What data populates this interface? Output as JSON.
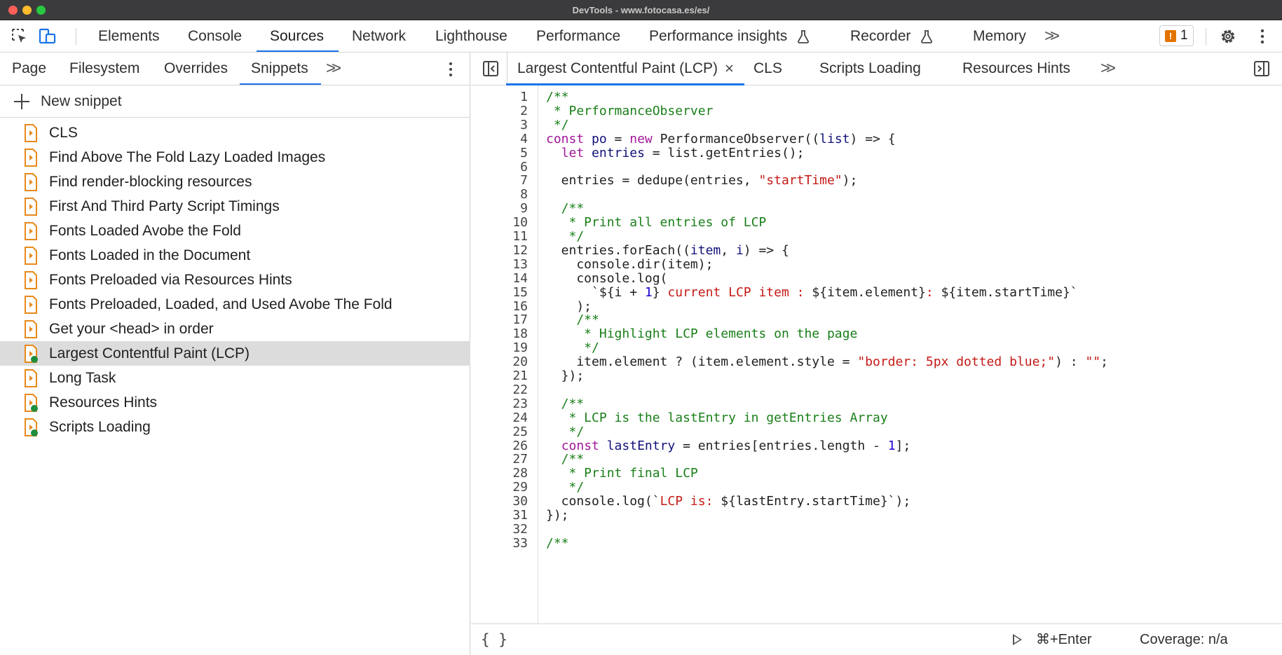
{
  "window": {
    "title": "DevTools - www.fotocasa.es/es/"
  },
  "colors": {
    "accent": "#1a73e8",
    "snippet_icon": "#e8891a",
    "running_dot": "#1e8e3e",
    "issue": "#e37400"
  },
  "toolbar": {
    "inspect_icon": "inspect-element-icon",
    "device_icon": "device-toolbar-icon",
    "tabs": [
      {
        "label": "Elements",
        "active": false
      },
      {
        "label": "Console",
        "active": false
      },
      {
        "label": "Sources",
        "active": true
      },
      {
        "label": "Network",
        "active": false
      },
      {
        "label": "Lighthouse",
        "active": false
      },
      {
        "label": "Performance",
        "active": false
      },
      {
        "label": "Performance insights",
        "active": false,
        "flask": true
      },
      {
        "label": "Recorder",
        "active": false,
        "flask": true
      },
      {
        "label": "Memory",
        "active": false
      }
    ],
    "more_tabs_icon": "chevron-double-right-icon",
    "issues_count": "1",
    "settings_icon": "gear-icon",
    "menu_icon": "kebab-menu-icon"
  },
  "navigator": {
    "tabs": [
      {
        "label": "Page",
        "active": false
      },
      {
        "label": "Filesystem",
        "active": false
      },
      {
        "label": "Overrides",
        "active": false
      },
      {
        "label": "Snippets",
        "active": true
      }
    ],
    "new_snippet_label": "New snippet",
    "snippets": [
      {
        "label": "CLS",
        "running": false,
        "selected": false
      },
      {
        "label": "Find Above The Fold Lazy Loaded Images",
        "running": false,
        "selected": false
      },
      {
        "label": "Find render-blocking resources",
        "running": false,
        "selected": false
      },
      {
        "label": "First And Third Party Script Timings",
        "running": false,
        "selected": false
      },
      {
        "label": "Fonts Loaded Avobe the Fold",
        "running": false,
        "selected": false
      },
      {
        "label": "Fonts Loaded in the Document",
        "running": false,
        "selected": false
      },
      {
        "label": "Fonts Preloaded via Resources Hints",
        "running": false,
        "selected": false
      },
      {
        "label": "Fonts Preloaded, Loaded, and Used Avobe The Fold",
        "running": false,
        "selected": false
      },
      {
        "label": "Get your <head> in order",
        "running": false,
        "selected": false
      },
      {
        "label": "Largest Contentful Paint (LCP)",
        "running": true,
        "selected": true
      },
      {
        "label": "Long Task",
        "running": false,
        "selected": false
      },
      {
        "label": "Resources Hints",
        "running": true,
        "selected": false
      },
      {
        "label": "Scripts Loading",
        "running": true,
        "selected": false
      }
    ]
  },
  "editor": {
    "tabs": [
      {
        "label": "Largest Contentful Paint (LCP)",
        "active": true,
        "closable": true
      },
      {
        "label": "CLS",
        "active": false
      },
      {
        "label": "Scripts Loading",
        "active": false
      },
      {
        "label": "Resources Hints",
        "active": false
      }
    ],
    "lines": [
      [
        [
          "c",
          "/**"
        ]
      ],
      [
        [
          "c",
          " * PerformanceObserver"
        ]
      ],
      [
        [
          "c",
          " */"
        ]
      ],
      [
        [
          "k",
          "const "
        ],
        [
          "d",
          "po"
        ],
        [
          "p",
          " = "
        ],
        [
          "k",
          "new "
        ],
        [
          "p",
          "PerformanceObserver(("
        ],
        [
          "d",
          "list"
        ],
        [
          "p",
          ") => {"
        ]
      ],
      [
        [
          "p",
          "  "
        ],
        [
          "k",
          "let "
        ],
        [
          "d",
          "entries"
        ],
        [
          "p",
          " = list.getEntries();"
        ]
      ],
      [],
      [
        [
          "p",
          "  entries = dedupe(entries, "
        ],
        [
          "s",
          "\"startTime\""
        ],
        [
          "p",
          ");"
        ]
      ],
      [],
      [
        [
          "c",
          "  /**"
        ]
      ],
      [
        [
          "c",
          "   * Print all entries of LCP"
        ]
      ],
      [
        [
          "c",
          "   */"
        ]
      ],
      [
        [
          "p",
          "  entries.forEach(("
        ],
        [
          "d",
          "item"
        ],
        [
          "p",
          ", "
        ],
        [
          "d",
          "i"
        ],
        [
          "p",
          ") => {"
        ]
      ],
      [
        [
          "p",
          "    console.dir(item);"
        ]
      ],
      [
        [
          "p",
          "    console.log("
        ]
      ],
      [
        [
          "p",
          "      `${i + "
        ],
        [
          "n",
          "1"
        ],
        [
          "p",
          "}"
        ],
        [
          "s",
          " current LCP item : "
        ],
        [
          "p",
          "${item.element}"
        ],
        [
          "s",
          ": "
        ],
        [
          "p",
          "${item.startTime}`"
        ]
      ],
      [
        [
          "p",
          "    );"
        ]
      ],
      [
        [
          "c",
          "    /**"
        ]
      ],
      [
        [
          "c",
          "     * Highlight LCP elements on the page"
        ]
      ],
      [
        [
          "c",
          "     */"
        ]
      ],
      [
        [
          "p",
          "    item.element ? (item.element.style = "
        ],
        [
          "s",
          "\"border: 5px dotted blue;\""
        ],
        [
          "p",
          ") : "
        ],
        [
          "s",
          "\"\""
        ],
        [
          "p",
          ";"
        ]
      ],
      [
        [
          "p",
          "  });"
        ]
      ],
      [],
      [
        [
          "c",
          "  /**"
        ]
      ],
      [
        [
          "c",
          "   * LCP is the lastEntry in getEntries Array"
        ]
      ],
      [
        [
          "c",
          "   */"
        ]
      ],
      [
        [
          "p",
          "  "
        ],
        [
          "k",
          "const "
        ],
        [
          "d",
          "lastEntry"
        ],
        [
          "p",
          " = entries[entries.length - "
        ],
        [
          "n",
          "1"
        ],
        [
          "p",
          "];"
        ]
      ],
      [
        [
          "c",
          "  /**"
        ]
      ],
      [
        [
          "c",
          "   * Print final LCP"
        ]
      ],
      [
        [
          "c",
          "   */"
        ]
      ],
      [
        [
          "p",
          "  console.log(`"
        ],
        [
          "s",
          "LCP is: "
        ],
        [
          "p",
          "${lastEntry.startTime}`);"
        ]
      ],
      [
        [
          "p",
          "});"
        ]
      ],
      [],
      [
        [
          "c",
          "/**"
        ]
      ]
    ]
  },
  "status": {
    "format_icon": "pretty-print-icon",
    "run_icon": "play-icon",
    "run_shortcut": "⌘+Enter",
    "coverage": "Coverage: n/a"
  }
}
